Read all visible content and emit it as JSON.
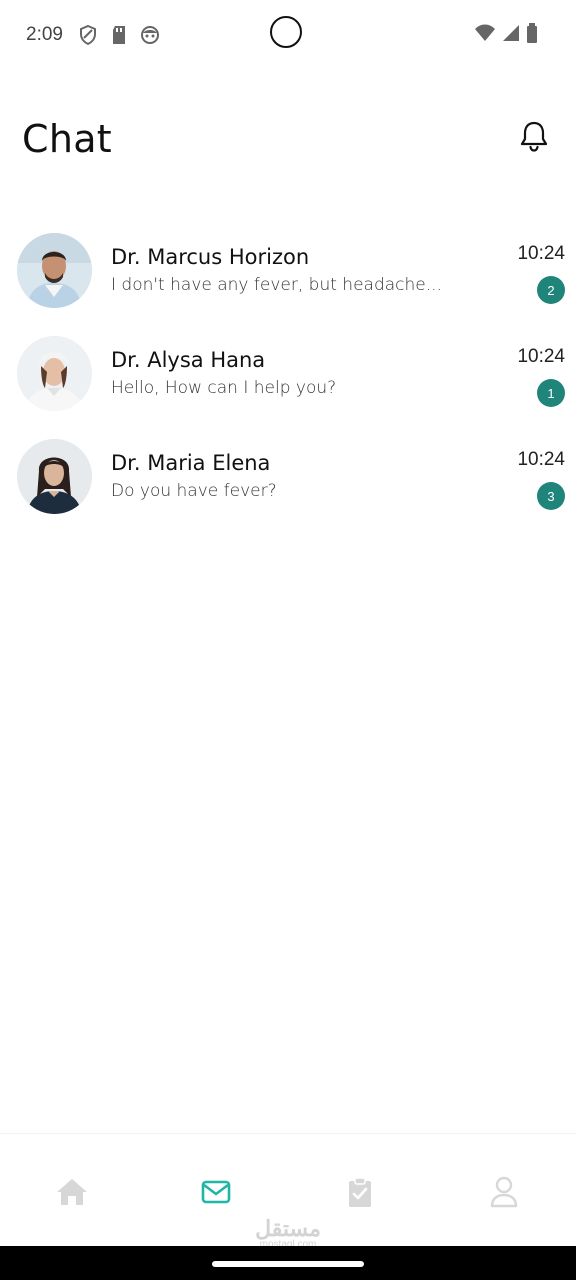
{
  "status_bar": {
    "time": "2:09",
    "left_icons": [
      "shield-icon",
      "sd-card-icon",
      "face-icon"
    ],
    "right_icons": [
      "wifi-icon",
      "signal-icon",
      "battery-icon"
    ]
  },
  "header": {
    "title": "Chat",
    "bell_icon": "bell-icon"
  },
  "chats": [
    {
      "name": "Dr. Marcus Horizon",
      "preview": "I don't have any fever, but headache...",
      "time": "10:24",
      "unread": "2"
    },
    {
      "name": "Dr. Alysa Hana",
      "preview": "Hello, How can I help you?",
      "time": "10:24",
      "unread": "1"
    },
    {
      "name": "Dr. Maria Elena",
      "preview": "Do you have fever?",
      "time": "10:24",
      "unread": "3"
    }
  ],
  "bottom_nav": {
    "items": [
      "home-icon",
      "mail-icon",
      "clipboard-check-icon",
      "user-icon"
    ],
    "active": "mail-icon"
  },
  "colors": {
    "accent": "#1fb5a7",
    "badge": "#1f857a",
    "inactive_icon": "#d7d7d7"
  },
  "watermark": {
    "arabic": "مستقل",
    "latin": "mostaql.com"
  }
}
